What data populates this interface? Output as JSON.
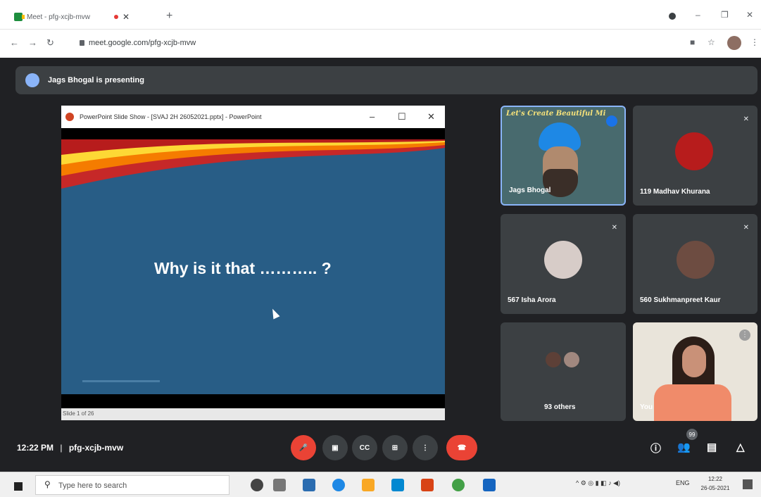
{
  "browser": {
    "tab_title": "Meet - pfg-xcjb-mvw",
    "tab_close": "✕",
    "new_tab": "+",
    "url": "meet.google.com/pfg-xcjb-mvw",
    "window_controls": [
      "–",
      "❐",
      "✕"
    ]
  },
  "meet": {
    "presenting_text": "Jags Bhogal is presenting",
    "shared_window_title": "PowerPoint Slide Show - [SVAJ 2H 26052021.pptx] - PowerPoint",
    "slide_text": "Why is it that ……….. ?",
    "slide_status": "Slide 1 of 26",
    "participants": [
      {
        "name": "Jags Bhogal",
        "video_banner": "Let's Create Beautiful Mi",
        "speaking": true
      },
      {
        "name": "119 Madhav Khurana",
        "muted": true
      },
      {
        "name": "567 Isha Arora",
        "muted": true
      },
      {
        "name": "560 Sukhmanpreet Kaur",
        "muted": true
      },
      {
        "name": "93 others"
      },
      {
        "name": "You"
      }
    ],
    "meeting_time": "12:22 PM",
    "meeting_separator": "|",
    "meeting_code": "pfg-xcjb-mvw",
    "people_count": "99",
    "colors": {
      "background": "#202124",
      "tile": "#3c4043",
      "danger": "#ea4335",
      "active_border": "#8ab4f8"
    }
  },
  "taskbar": {
    "search_placeholder": "Type here to search",
    "tray_lang": "ENG",
    "clock_time": "12:22",
    "clock_date": "26-05-2021"
  }
}
